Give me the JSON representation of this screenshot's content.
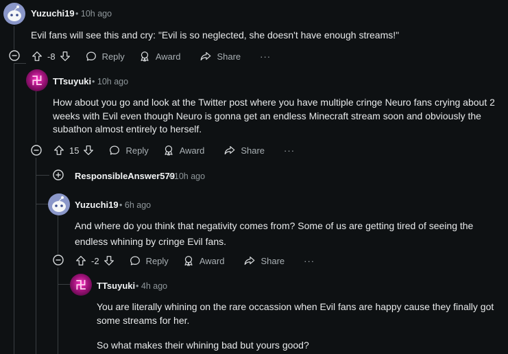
{
  "comments": [
    {
      "user": "Yuzuchi19",
      "time": "10h ago",
      "body": [
        "Evil fans will see this and cry: \"Evil is so neglected, she doesn't have enough streams!\""
      ],
      "score": "-8",
      "avatar": "snoo"
    },
    {
      "user": "TTsuyuki",
      "time": "10h ago",
      "body": [
        "How about you go and look at the Twitter post where you have multiple cringe Neuro fans crying about 2",
        "weeks with Evil even though Neuro is gonna get an endless Minecraft stream soon and obviously the",
        "subathon almost entirely to herself."
      ],
      "score": "15",
      "avatar": "tt"
    },
    {
      "user": "ResponsibleAnswer579",
      "time": "10h ago",
      "collapsed": true
    },
    {
      "user": "Yuzuchi19",
      "time": "6h ago",
      "body": [
        "And where do you think that negativity comes from? Some of us are getting tired of seeing the",
        "endless whining by cringe Evil fans."
      ],
      "score": "-2",
      "avatar": "snoo"
    },
    {
      "user": "TTsuyuki",
      "time": "4h ago",
      "body": [
        "You are literally whining on the rare occassion when Evil fans are happy cause they finally got",
        "some streams for her."
      ],
      "body2": "So what makes their whining bad but yours good?",
      "avatar": "tt"
    }
  ],
  "actions": {
    "reply": "Reply",
    "award": "Award",
    "share": "Share",
    "more": "···"
  },
  "separator": "•",
  "avatar_glyph": "卍",
  "icons": [
    "upvote-icon",
    "downvote-icon",
    "reply-icon",
    "award-icon",
    "share-icon",
    "more-icon",
    "collapse-icon",
    "expand-icon"
  ],
  "colors": {
    "background": "#0e1113",
    "text": "#d7dadc",
    "muted": "#8f979b",
    "thread_line": "#3a3f42",
    "snoo_avatar": "#8a97c9",
    "tt_avatar": "#c0158f"
  }
}
